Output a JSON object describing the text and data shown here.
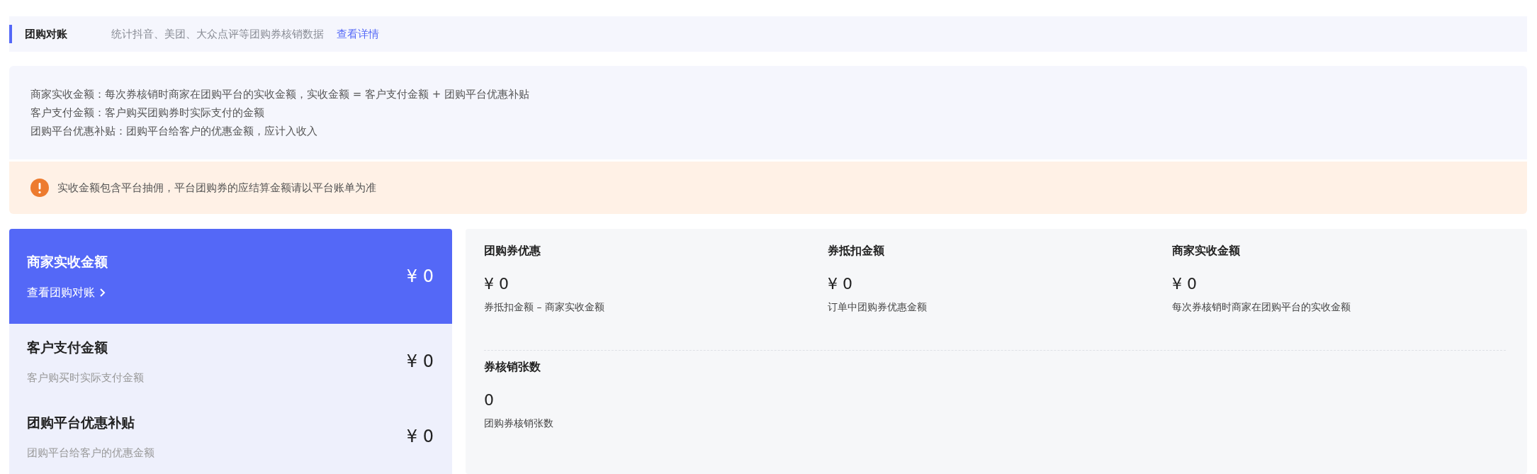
{
  "header": {
    "title": "团购对账",
    "description": "统计抖音、美团、大众点评等团购券核销数据",
    "link": "查看详情"
  },
  "notes": [
    "商家实收金额：每次券核销时商家在团购平台的实收金额，实收金额 = 客户支付金额 + 团购平台优惠补贴",
    "客户支付金额：客户购买团购券时实际支付的金额",
    "团购平台优惠补贴：团购平台给客户的优惠金额，应计入收入"
  ],
  "warning": {
    "text": "实收金额包含平台抽佣，平台团购券的应结算金额请以平台账单为准"
  },
  "summary": [
    {
      "title": "商家实收金额",
      "link": "查看团购对账",
      "value": "¥ 0",
      "selected": true
    },
    {
      "title": "客户支付金额",
      "subtitle": "客户购买时实际支付金额",
      "value": "¥ 0",
      "selected": false
    },
    {
      "title": "团购平台优惠补贴",
      "subtitle": "团购平台给客户的优惠金额",
      "value": "¥ 0",
      "selected": false
    }
  ],
  "stats": [
    {
      "label": "团购券优惠",
      "value": "¥ 0",
      "description": "券抵扣金额 – 商家实收金额"
    },
    {
      "label": "券抵扣金额",
      "value": "¥ 0",
      "description": "订单中团购券优惠金额"
    },
    {
      "label": "商家实收金额",
      "value": "¥ 0",
      "description": "每次券核销时商家在团购平台的实收金额"
    },
    {
      "label": "券核销张数",
      "value": "0",
      "description": "团购券核销张数"
    }
  ]
}
